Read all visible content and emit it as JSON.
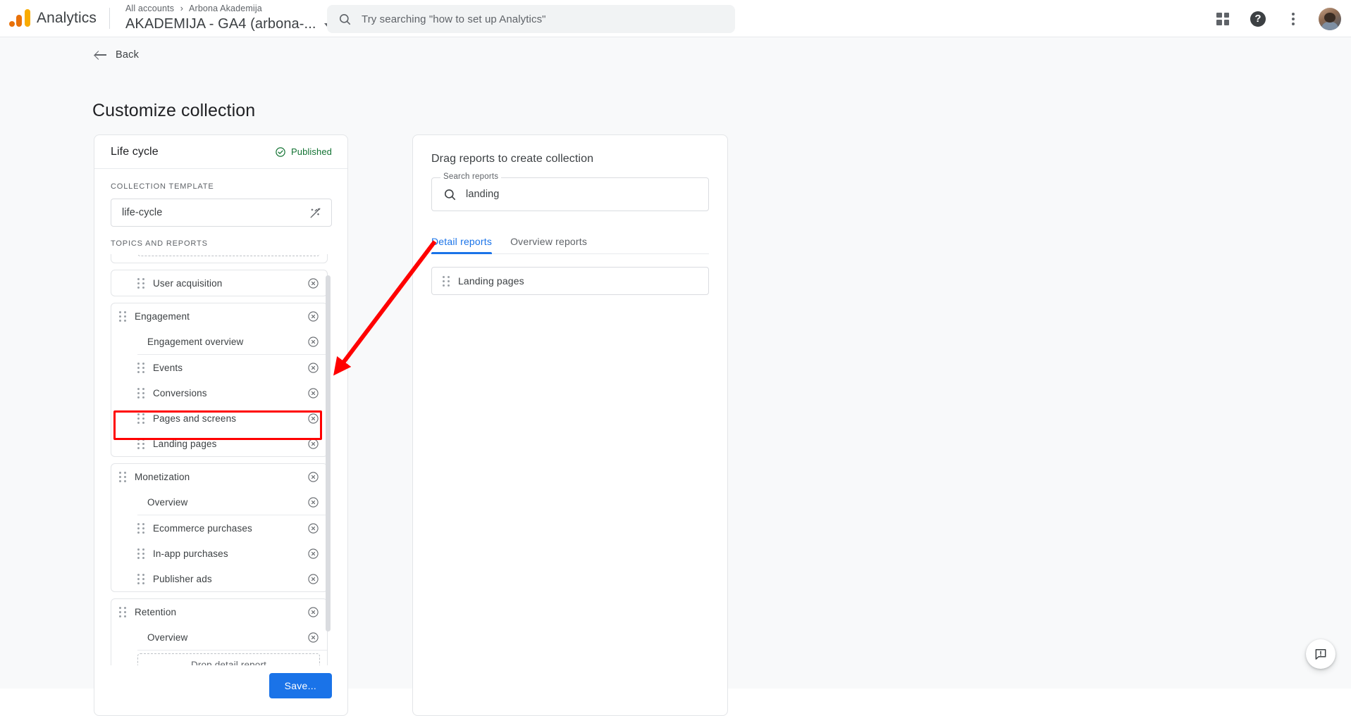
{
  "topbar": {
    "logo_icon": "analytics-logo",
    "brand": "Analytics",
    "breadcrumb_root": "All accounts",
    "breadcrumb_sep": "›",
    "breadcrumb_account": "Arbona Akademija",
    "property": "AKADEMIJA - GA4 (arbona-...",
    "search_placeholder": "Try searching \"how to set up Analytics\"",
    "search_icon": "search-icon",
    "apps_icon": "apps-grid-icon",
    "help_icon": "help-icon",
    "help_glyph": "?",
    "kebab_icon": "more-options-icon",
    "avatar_icon": "user-avatar"
  },
  "page": {
    "back_label": "Back",
    "back_icon": "arrow-left-icon",
    "title": "Customize collection"
  },
  "left_panel": {
    "title": "Life cycle",
    "status": "Published",
    "status_icon": "check-circle-icon",
    "status_color": "#137333",
    "template_section_label": "Collection template",
    "template_value": "life-cycle",
    "template_icon": "auto-fix-off-icon",
    "topics_section_label": "Topics and reports",
    "drag_handle_icon": "drag-handle-icon",
    "remove_icon": "remove-circle-icon",
    "partial_drop_label": "",
    "groups": [
      {
        "rows": [
          {
            "label": "User acquisition",
            "type": "report",
            "handle": true,
            "remove": true
          }
        ]
      },
      {
        "rows": [
          {
            "label": "Engagement",
            "type": "topic",
            "handle": true,
            "remove": true
          },
          {
            "label": "Engagement overview",
            "type": "overview",
            "handle": false,
            "remove": true
          },
          {
            "label": "Events",
            "type": "report",
            "handle": true,
            "remove": true
          },
          {
            "label": "Conversions",
            "type": "report",
            "handle": true,
            "remove": true
          },
          {
            "label": "Pages and screens",
            "type": "report",
            "handle": true,
            "remove": true
          },
          {
            "label": "Landing pages",
            "type": "report",
            "handle": true,
            "remove": true,
            "highlighted": true
          }
        ]
      },
      {
        "rows": [
          {
            "label": "Monetization",
            "type": "topic",
            "handle": true,
            "remove": true
          },
          {
            "label": "Overview",
            "type": "overview",
            "handle": false,
            "remove": true
          },
          {
            "label": "Ecommerce purchases",
            "type": "report",
            "handle": true,
            "remove": true
          },
          {
            "label": "In-app purchases",
            "type": "report",
            "handle": true,
            "remove": true
          },
          {
            "label": "Publisher ads",
            "type": "report",
            "handle": true,
            "remove": true
          }
        ]
      },
      {
        "rows": [
          {
            "label": "Retention",
            "type": "topic",
            "handle": true,
            "remove": true
          },
          {
            "label": "Overview",
            "type": "overview",
            "handle": false,
            "remove": true
          }
        ],
        "drop_label": "Drop detail report"
      }
    ],
    "save_label": "Save..."
  },
  "right_panel": {
    "title": "Drag reports to create collection",
    "search_legend": "Search reports",
    "search_value": "landing",
    "search_icon": "search-icon",
    "tabs": [
      {
        "label": "Detail reports",
        "active": true
      },
      {
        "label": "Overview reports",
        "active": false
      }
    ],
    "reports": [
      {
        "label": "Landing pages",
        "handle_icon": "drag-handle-icon"
      }
    ]
  },
  "annotations": {
    "highlight_color": "#ff0000",
    "highlight_target": "Landing pages",
    "arrow_from": "Landing pages report card",
    "arrow_to": "Landing pages row in Engagement topic"
  },
  "feedback": {
    "icon": "feedback-icon",
    "label": "Send feedback"
  }
}
